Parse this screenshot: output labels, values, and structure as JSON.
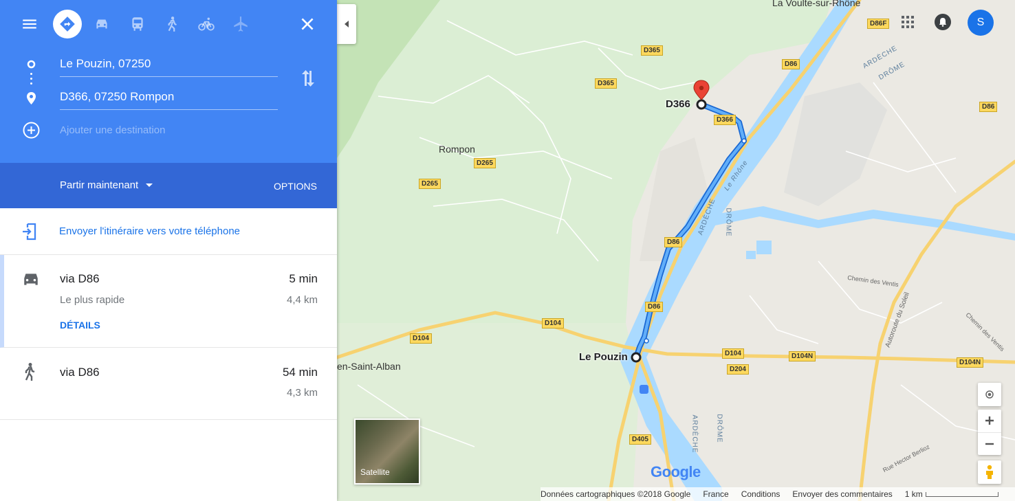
{
  "colors": {
    "header_blue": "#4285f4",
    "bar_blue": "#3367d6",
    "route_blue": "#1a73e8",
    "river": "#aadaff"
  },
  "header": {
    "modes": [
      "menu-icon",
      "directions-icon",
      "car-icon",
      "transit-icon",
      "walk-icon",
      "bike-icon",
      "flight-icon",
      "close-icon"
    ]
  },
  "waypoints": {
    "origin": "Le Pouzin, 07250",
    "destination": "D366, 07250 Rompon",
    "add_placeholder": "Ajouter une destination"
  },
  "depart": {
    "label": "Partir maintenant",
    "options": "OPTIONS"
  },
  "send_to_phone": "Envoyer l'itinéraire vers votre téléphone",
  "routes": [
    {
      "mode": "car-icon",
      "via": "via D86",
      "time": "5 min",
      "subtitle": "Le plus rapide",
      "distance": "4,4 km",
      "details": "DÉTAILS"
    },
    {
      "mode": "walk-icon",
      "via": "via D86",
      "time": "54 min",
      "distance": "4,3 km"
    }
  ],
  "map": {
    "places": {
      "la_voulte": "La Voulte-sur-Rhône",
      "rompon": "Rompon",
      "d366_end": "D366",
      "le_pouzin": "Le Pouzin",
      "saint_alban": "en-Saint-Alban"
    },
    "shields": {
      "d365_top": "D365",
      "d365_mid": "D365",
      "d86_top": "D86",
      "d86_right": "D86",
      "d86f": "D86F",
      "d366": "D366",
      "d265_a": "D265",
      "d265_b": "D265",
      "d86_mid": "D86",
      "d86_low": "D86",
      "d104_a": "D104",
      "d104_b": "D104",
      "d104_c": "D104",
      "d104n_a": "D104N",
      "d104n_b": "D104N",
      "d204": "D204",
      "d405": "D405"
    },
    "river_labels": {
      "ardeche_top": "ARDÈCHE",
      "drome_top": "DRÔME",
      "le_rhone": "Le Rhône",
      "ardeche_mid": "ARDÈCHE",
      "drome_mid": "DRÔME",
      "ardeche_low": "ARDÈCHE",
      "drome_low": "DRÔME"
    },
    "streets": {
      "chemin_ventis": "Chemin des Ventis",
      "chemin_ventis2": "Chemin des Ventis",
      "autoroute": "Autoroute du Soleil",
      "rue_berlioz": "Rue Hector Berlioz"
    },
    "satellite_label": "Satellite",
    "google_logo": "Google",
    "account_initial": "S",
    "footer": {
      "data": "Données cartographiques ©2018 Google",
      "country": "France",
      "conditions": "Conditions",
      "feedback": "Envoyer des commentaires",
      "scale": "1 km"
    }
  }
}
